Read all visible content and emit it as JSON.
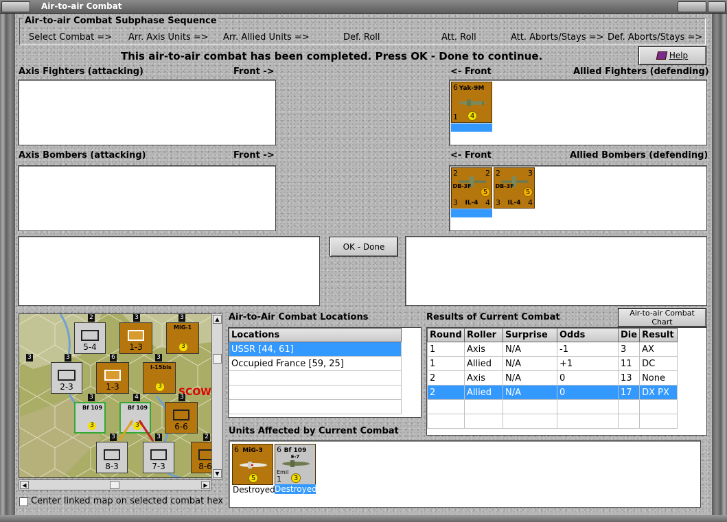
{
  "window": {
    "title": "Air-to-air Combat"
  },
  "sequence": {
    "title": "Air-to-air Combat Subphase Sequence",
    "steps": [
      "Select Combat =>",
      "Arr. Axis Units =>",
      "Arr. Allied Units =>",
      "Def. Roll",
      "Att. Roll",
      "Att. Aborts/Stays =>",
      "Def. Aborts/Stays =>"
    ]
  },
  "status_message": "This air-to-air combat has been completed.  Press OK - Done to continue.",
  "help_button": "Help",
  "axis_fighters": {
    "label": "Axis Fighters (attacking)",
    "front": "Front ->"
  },
  "allied_fighters": {
    "label": "Allied Fighters (defending)",
    "front": "<- Front",
    "units": [
      {
        "name": "Yak-9M",
        "tl": "6",
        "bl": "1",
        "circle": "4"
      }
    ]
  },
  "axis_bombers": {
    "label": "Axis Bombers (attacking)",
    "front": "Front ->"
  },
  "allied_bombers": {
    "label": "Allied Bombers (defending)",
    "front": "<- Front",
    "units": [
      {
        "name": "DB-3F",
        "name2": "IL-4",
        "tl": "2",
        "tr": "2",
        "bl": "3",
        "br": "4",
        "circle": "5"
      },
      {
        "name": "DB-3F",
        "name2": "IL-4",
        "tl": "2",
        "tr": "3",
        "bl": "3",
        "br": "4",
        "circle": "5"
      }
    ]
  },
  "ok_button": "OK - Done",
  "locations": {
    "title": "Air-to-Air Combat Locations",
    "header": "Locations",
    "rows": [
      "USSR [44, 61]",
      "Occupied France [59, 25]",
      "",
      "",
      ""
    ]
  },
  "results": {
    "title": "Results of Current Combat",
    "chart_button": "Air-to-air Combat Chart",
    "headers": [
      "Round",
      "Roller",
      "Surprise",
      "Odds",
      "Die",
      "Result"
    ],
    "rows": [
      [
        "1",
        "Axis",
        "N/A",
        "-1",
        "3",
        "AX"
      ],
      [
        "1",
        "Allied",
        "N/A",
        "+1",
        "11",
        "DC"
      ],
      [
        "2",
        "Axis",
        "N/A",
        "0",
        "13",
        "None"
      ],
      [
        "2",
        "Allied",
        "N/A",
        "0",
        "17",
        "DX PX"
      ],
      [
        "",
        "",
        "",
        "",
        "",
        ""
      ],
      [
        "",
        "",
        "",
        "",
        "",
        ""
      ]
    ]
  },
  "affected": {
    "title": "Units Affected by Current Combat",
    "units": [
      {
        "name": "MiG-3",
        "tl": "6",
        "circle": "5",
        "status": "Destroyed"
      },
      {
        "name": "Bf 109",
        "sub": "E-7",
        "sub2": "Emil",
        "tl": "6",
        "bl": "1",
        "circle": "3",
        "status": "Destroyed"
      }
    ]
  },
  "map": {
    "hex_labels": [
      "5-4",
      "1-3",
      "2-3",
      "1-3",
      "6-6",
      "8-3",
      "7-3",
      "8-6"
    ],
    "unit_names": [
      "MiG-1",
      "I-15bis",
      "Bf 109",
      "Bf 109"
    ],
    "city_text": "SCOW",
    "stack_numbers": [
      "2",
      "3",
      "3",
      "3",
      "6",
      "3",
      "3",
      "4",
      "3",
      "3",
      "3",
      "2",
      "3"
    ]
  },
  "center_checkbox": "Center linked map on selected combat hex"
}
